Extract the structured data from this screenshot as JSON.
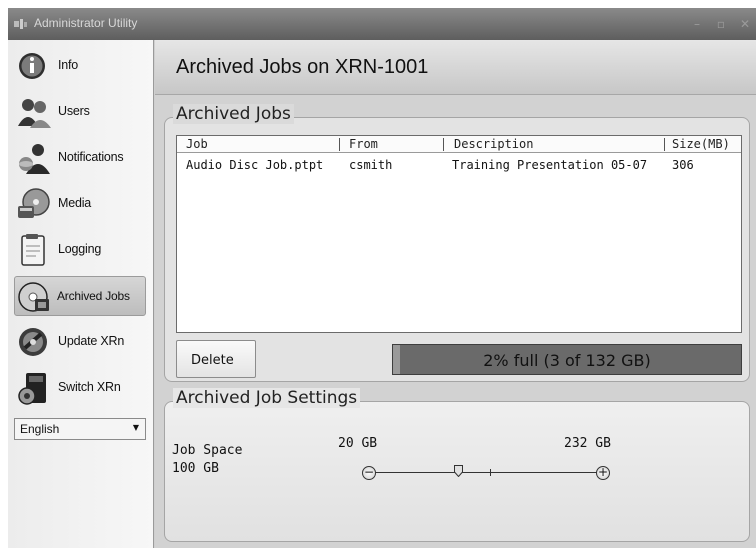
{
  "window": {
    "title": "Administrator Utility"
  },
  "sidebar": {
    "items": [
      {
        "label": "Info",
        "icon": "info-icon",
        "active": false
      },
      {
        "label": "Users",
        "icon": "users-icon",
        "active": false
      },
      {
        "label": "Notifications",
        "icon": "notifications-icon",
        "active": false
      },
      {
        "label": "Media",
        "icon": "media-icon",
        "active": false
      },
      {
        "label": "Logging",
        "icon": "logging-icon",
        "active": false
      },
      {
        "label": "Archived Jobs",
        "icon": "archived-jobs-icon",
        "active": true
      },
      {
        "label": "Update XRn",
        "icon": "update-icon",
        "active": false
      },
      {
        "label": "Switch XRn",
        "icon": "switch-icon",
        "active": false
      }
    ],
    "language": "English"
  },
  "main": {
    "title": "Archived Jobs on XRN-1001",
    "archived_jobs": {
      "group_title": "Archived Jobs",
      "columns": [
        "Job",
        "From",
        "Description",
        "Size(MB)"
      ],
      "rows": [
        {
          "job": "Audio Disc Job.ptpt",
          "from": "csmith",
          "description": "Training Presentation 05-07",
          "size": "306"
        }
      ],
      "delete_label": "Delete",
      "usage_text": "2% full (3 of 132 GB)",
      "usage_fraction": 0.02
    },
    "settings": {
      "group_title": "Archived Job Settings",
      "job_space_label": "Job Space",
      "job_space_value": "100 GB",
      "slider_min": "20 GB",
      "slider_max": "232 GB"
    }
  },
  "colors": {
    "title_bar": "#6e6e6e",
    "usage_bar": "#6a6a6a",
    "background": "#d2d2d2"
  }
}
